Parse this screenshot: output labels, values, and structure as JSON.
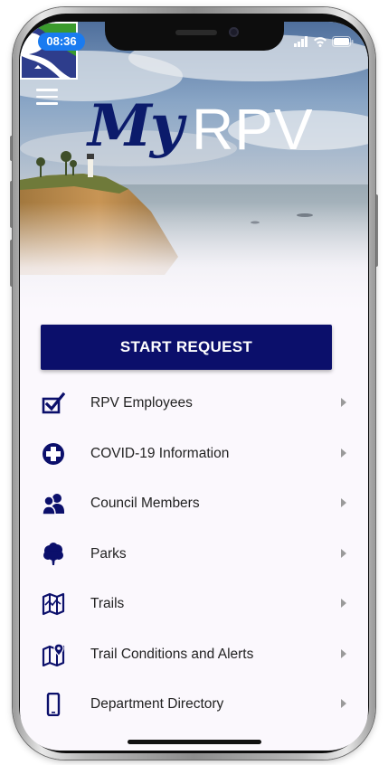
{
  "status_bar": {
    "time": "08:36"
  },
  "header": {
    "logo_my": "My",
    "logo_rpv": "RPV"
  },
  "start_request": {
    "label": "START REQUEST"
  },
  "menu": {
    "items": [
      {
        "label": "RPV Employees",
        "icon": "checkbox-icon"
      },
      {
        "label": "COVID-19 Information",
        "icon": "medical-cross-icon"
      },
      {
        "label": "Council Members",
        "icon": "people-icon"
      },
      {
        "label": "Parks",
        "icon": "tree-icon"
      },
      {
        "label": "Trails",
        "icon": "map-icon"
      },
      {
        "label": "Trail Conditions and Alerts",
        "icon": "map-pin-icon"
      },
      {
        "label": "Department Directory",
        "icon": "mobile-phone-icon"
      }
    ]
  },
  "colors": {
    "primary": "#0b0f6b",
    "list_background": "#fbf8fd",
    "time_pill": "#1a7bf0",
    "logo_green": "#3a9a2c"
  }
}
